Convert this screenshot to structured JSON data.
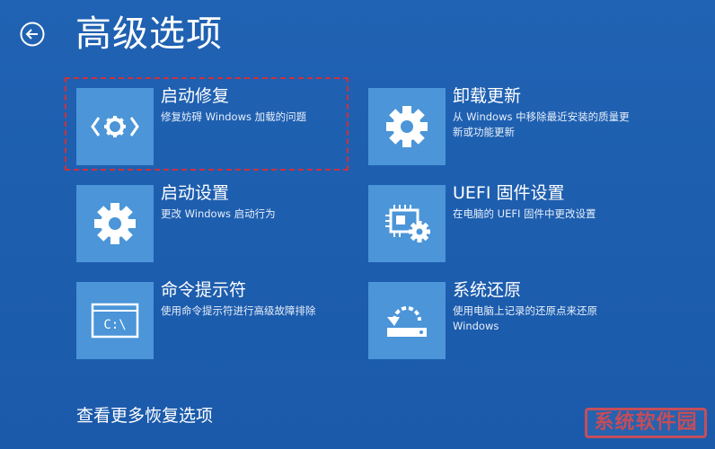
{
  "header": {
    "title": "高级选项"
  },
  "options": [
    {
      "title": "启动修复",
      "description": "修复妨碍 Windows 加载的问题",
      "icon": "startup-repair-icon",
      "highlighted": true
    },
    {
      "title": "卸载更新",
      "description": "从 Windows 中移除最近安装的质量更新或功能更新",
      "icon": "gear-icon"
    },
    {
      "title": "启动设置",
      "description": "更改 Windows 启动行为",
      "icon": "gear-icon"
    },
    {
      "title": "UEFI 固件设置",
      "description": "在电脑的 UEFI 固件中更改设置",
      "icon": "firmware-chip-gear-icon"
    },
    {
      "title": "命令提示符",
      "description": "使用命令提示符进行高级故障排除",
      "icon": "command-prompt-icon",
      "icon_text": "C:\\"
    },
    {
      "title": "系统还原",
      "description": "使用电脑上记录的还原点来还原 Windows",
      "icon": "system-restore-icon"
    }
  ],
  "footer": {
    "more_options": "查看更多恢复选项"
  },
  "watermark": {
    "text": "系统软件园"
  },
  "colors": {
    "background": "#1e5fb0",
    "tile": "#4b95d8",
    "highlight_border": "#d0303a",
    "text": "#ffffff"
  }
}
